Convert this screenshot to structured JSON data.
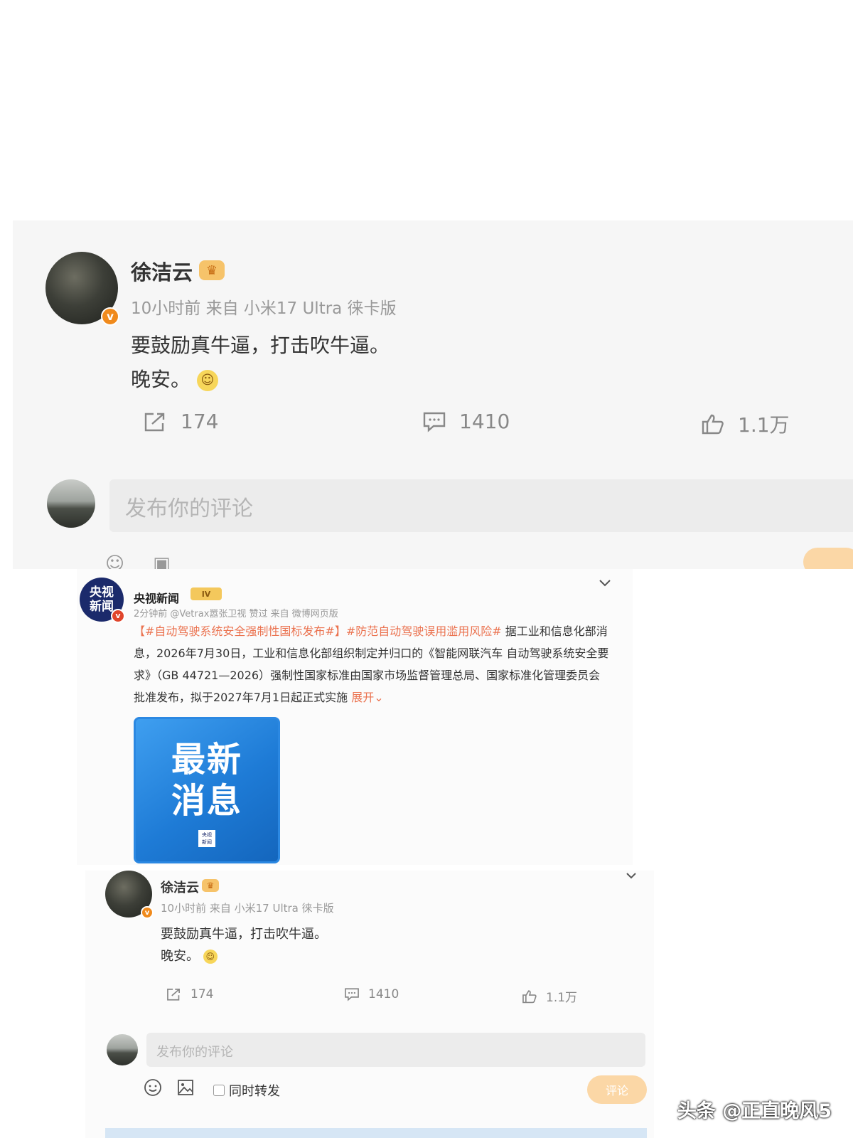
{
  "top_post": {
    "author": "徐洁云",
    "meta": "10小时前  来自 小米17 Ultra 徕卡版",
    "text_line1": "要鼓励真牛逼，打击吹牛逼。",
    "text_line2": "晚安。",
    "repost_count": "174",
    "comment_count": "1410",
    "like_count": "1.1万",
    "comment_placeholder": "发布你的评论"
  },
  "cctv_post": {
    "logo_text": "央视\n新闻",
    "author": "央视新闻",
    "level_badge": "IV",
    "meta": "2分钟前 @Vetrax嚣张卫视 赞过  来自 微博网页版",
    "tag1": "【#自动驾驶系统安全强制性国标发布#】",
    "tag2": "#防范自动驾驶误用滥用风险#",
    "body": " 据工业和信息化部消息，2026年7月30日，工业和信息化部组织制定并归口的《智能网联汽车 自动驾驶系统安全要求》（GB 44721—2026）强制性国家标准由国家市场监督管理总局、国家标准化管理委员会批准发布，拟于2027年7月1日起正式实施",
    "expand_label": "展开",
    "card_line1": "最新",
    "card_line2": "消息",
    "card_logo": "央视新闻"
  },
  "small_post": {
    "author": "徐洁云",
    "meta": "10小时前 来自 小米17 Ultra 徕卡版",
    "text_line1": "要鼓励真牛逼，打击吹牛逼。",
    "text_line2": "晚安。",
    "repost_count": "174",
    "comment_count": "1410",
    "like_count": "1.1万",
    "comment_placeholder": "发布你的评论",
    "repost_checkbox_label": "同时转发",
    "post_button_label": "评论"
  },
  "watermark": "头条 @正直晚风5",
  "colors": {
    "verify_orange": "#f08a1c",
    "tag_orange": "#eb7350",
    "news_blue": "#1e7bd6",
    "post_button": "#fbd7a6"
  },
  "icons": [
    "verified-badge-icon",
    "crown-icon",
    "smile-emoji-icon",
    "repost-icon",
    "comment-icon",
    "like-icon",
    "chevron-down-icon",
    "emoji-icon",
    "image-icon"
  ]
}
